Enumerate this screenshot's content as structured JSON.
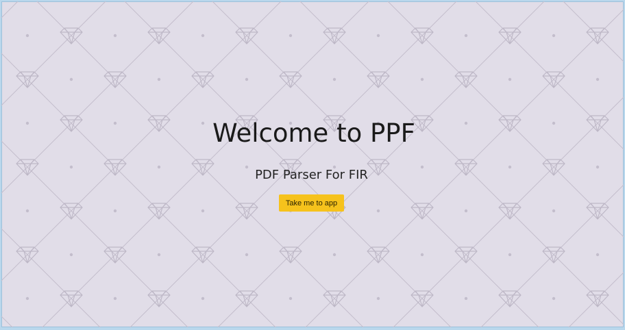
{
  "hero": {
    "title": "Welcome to PPF",
    "subtitle": "PDF Parser For FIR",
    "cta_label": "Take me to app"
  },
  "colors": {
    "background": "#e1dde8",
    "pattern": "#bdb7c6",
    "cta": "#f6c21c",
    "frame_border": "#b9d7ec"
  },
  "decoration": {
    "pattern_icon": "diamond-icon"
  }
}
